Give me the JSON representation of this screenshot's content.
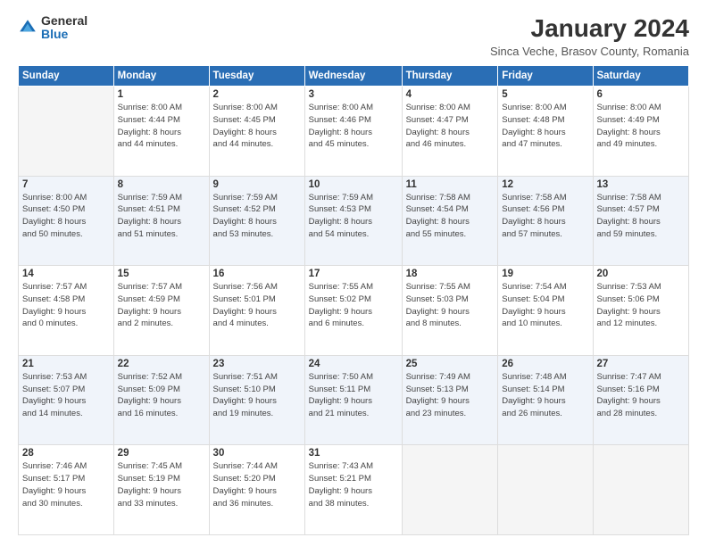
{
  "logo": {
    "general": "General",
    "blue": "Blue"
  },
  "header": {
    "month_title": "January 2024",
    "location": "Sinca Veche, Brasov County, Romania"
  },
  "weekdays": [
    "Sunday",
    "Monday",
    "Tuesday",
    "Wednesday",
    "Thursday",
    "Friday",
    "Saturday"
  ],
  "weeks": [
    [
      {
        "day": "",
        "info": ""
      },
      {
        "day": "1",
        "info": "Sunrise: 8:00 AM\nSunset: 4:44 PM\nDaylight: 8 hours\nand 44 minutes."
      },
      {
        "day": "2",
        "info": "Sunrise: 8:00 AM\nSunset: 4:45 PM\nDaylight: 8 hours\nand 44 minutes."
      },
      {
        "day": "3",
        "info": "Sunrise: 8:00 AM\nSunset: 4:46 PM\nDaylight: 8 hours\nand 45 minutes."
      },
      {
        "day": "4",
        "info": "Sunrise: 8:00 AM\nSunset: 4:47 PM\nDaylight: 8 hours\nand 46 minutes."
      },
      {
        "day": "5",
        "info": "Sunrise: 8:00 AM\nSunset: 4:48 PM\nDaylight: 8 hours\nand 47 minutes."
      },
      {
        "day": "6",
        "info": "Sunrise: 8:00 AM\nSunset: 4:49 PM\nDaylight: 8 hours\nand 49 minutes."
      }
    ],
    [
      {
        "day": "7",
        "info": "Sunrise: 8:00 AM\nSunset: 4:50 PM\nDaylight: 8 hours\nand 50 minutes."
      },
      {
        "day": "8",
        "info": "Sunrise: 7:59 AM\nSunset: 4:51 PM\nDaylight: 8 hours\nand 51 minutes."
      },
      {
        "day": "9",
        "info": "Sunrise: 7:59 AM\nSunset: 4:52 PM\nDaylight: 8 hours\nand 53 minutes."
      },
      {
        "day": "10",
        "info": "Sunrise: 7:59 AM\nSunset: 4:53 PM\nDaylight: 8 hours\nand 54 minutes."
      },
      {
        "day": "11",
        "info": "Sunrise: 7:58 AM\nSunset: 4:54 PM\nDaylight: 8 hours\nand 55 minutes."
      },
      {
        "day": "12",
        "info": "Sunrise: 7:58 AM\nSunset: 4:56 PM\nDaylight: 8 hours\nand 57 minutes."
      },
      {
        "day": "13",
        "info": "Sunrise: 7:58 AM\nSunset: 4:57 PM\nDaylight: 8 hours\nand 59 minutes."
      }
    ],
    [
      {
        "day": "14",
        "info": "Sunrise: 7:57 AM\nSunset: 4:58 PM\nDaylight: 9 hours\nand 0 minutes."
      },
      {
        "day": "15",
        "info": "Sunrise: 7:57 AM\nSunset: 4:59 PM\nDaylight: 9 hours\nand 2 minutes."
      },
      {
        "day": "16",
        "info": "Sunrise: 7:56 AM\nSunset: 5:01 PM\nDaylight: 9 hours\nand 4 minutes."
      },
      {
        "day": "17",
        "info": "Sunrise: 7:55 AM\nSunset: 5:02 PM\nDaylight: 9 hours\nand 6 minutes."
      },
      {
        "day": "18",
        "info": "Sunrise: 7:55 AM\nSunset: 5:03 PM\nDaylight: 9 hours\nand 8 minutes."
      },
      {
        "day": "19",
        "info": "Sunrise: 7:54 AM\nSunset: 5:04 PM\nDaylight: 9 hours\nand 10 minutes."
      },
      {
        "day": "20",
        "info": "Sunrise: 7:53 AM\nSunset: 5:06 PM\nDaylight: 9 hours\nand 12 minutes."
      }
    ],
    [
      {
        "day": "21",
        "info": "Sunrise: 7:53 AM\nSunset: 5:07 PM\nDaylight: 9 hours\nand 14 minutes."
      },
      {
        "day": "22",
        "info": "Sunrise: 7:52 AM\nSunset: 5:09 PM\nDaylight: 9 hours\nand 16 minutes."
      },
      {
        "day": "23",
        "info": "Sunrise: 7:51 AM\nSunset: 5:10 PM\nDaylight: 9 hours\nand 19 minutes."
      },
      {
        "day": "24",
        "info": "Sunrise: 7:50 AM\nSunset: 5:11 PM\nDaylight: 9 hours\nand 21 minutes."
      },
      {
        "day": "25",
        "info": "Sunrise: 7:49 AM\nSunset: 5:13 PM\nDaylight: 9 hours\nand 23 minutes."
      },
      {
        "day": "26",
        "info": "Sunrise: 7:48 AM\nSunset: 5:14 PM\nDaylight: 9 hours\nand 26 minutes."
      },
      {
        "day": "27",
        "info": "Sunrise: 7:47 AM\nSunset: 5:16 PM\nDaylight: 9 hours\nand 28 minutes."
      }
    ],
    [
      {
        "day": "28",
        "info": "Sunrise: 7:46 AM\nSunset: 5:17 PM\nDaylight: 9 hours\nand 30 minutes."
      },
      {
        "day": "29",
        "info": "Sunrise: 7:45 AM\nSunset: 5:19 PM\nDaylight: 9 hours\nand 33 minutes."
      },
      {
        "day": "30",
        "info": "Sunrise: 7:44 AM\nSunset: 5:20 PM\nDaylight: 9 hours\nand 36 minutes."
      },
      {
        "day": "31",
        "info": "Sunrise: 7:43 AM\nSunset: 5:21 PM\nDaylight: 9 hours\nand 38 minutes."
      },
      {
        "day": "",
        "info": ""
      },
      {
        "day": "",
        "info": ""
      },
      {
        "day": "",
        "info": ""
      }
    ]
  ]
}
